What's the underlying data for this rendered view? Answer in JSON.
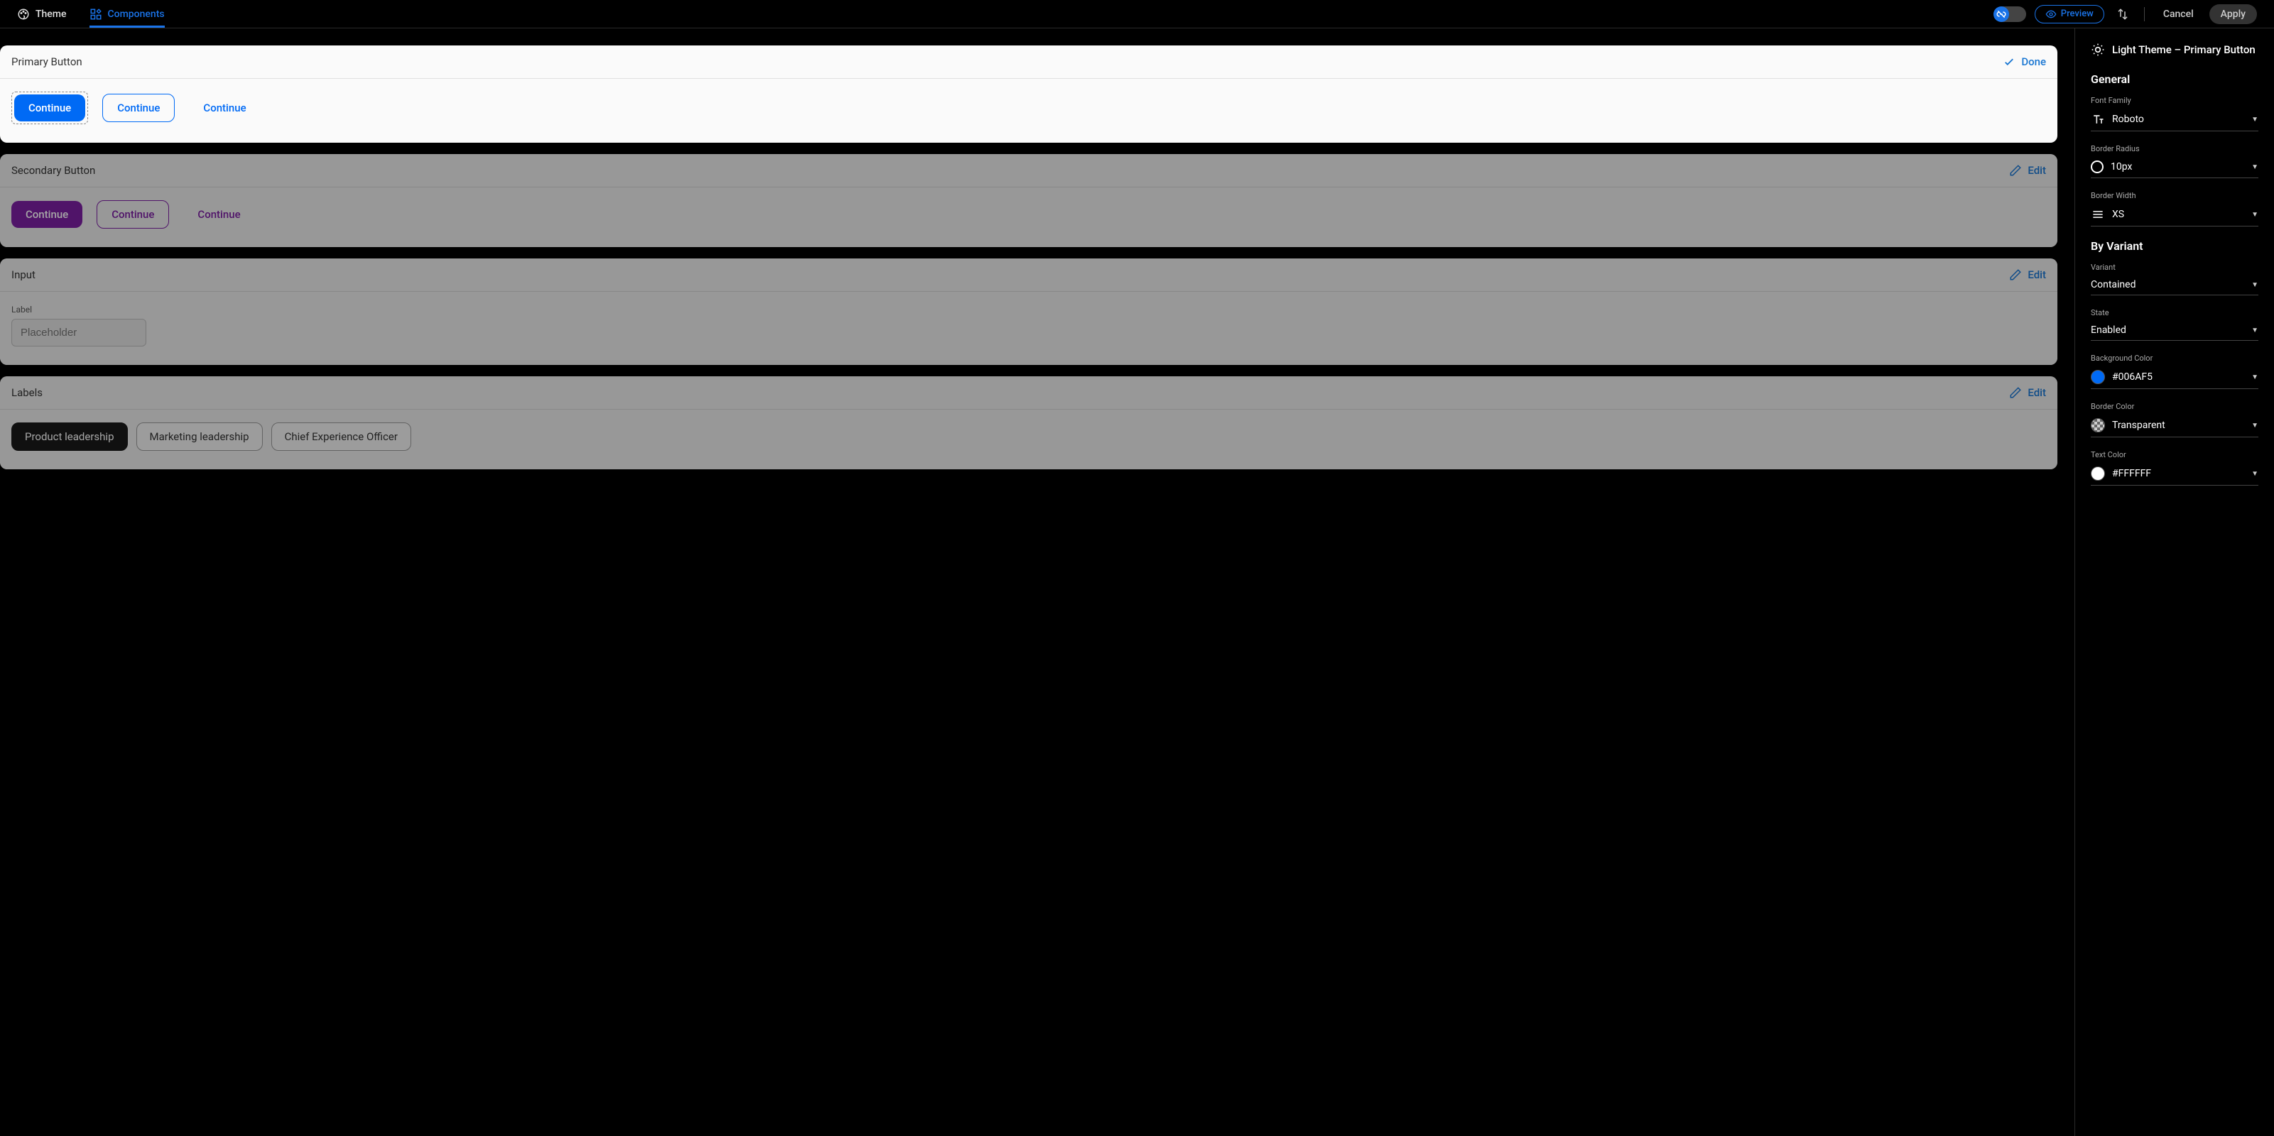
{
  "tabs": {
    "theme": "Theme",
    "components": "Components"
  },
  "topbar": {
    "preview": "Preview",
    "cancel": "Cancel",
    "apply": "Apply"
  },
  "cards": {
    "primary": {
      "title": "Primary Button",
      "action": "Done",
      "accent": "#006af5",
      "samples": [
        "Continue",
        "Continue",
        "Continue"
      ]
    },
    "secondary": {
      "title": "Secondary Button",
      "action": "Edit",
      "accent": "#7b1fa2",
      "samples": [
        "Continue",
        "Continue",
        "Continue"
      ]
    },
    "input": {
      "title": "Input",
      "action": "Edit",
      "label": "Label",
      "placeholder": "Placeholder"
    },
    "labels": {
      "title": "Labels",
      "action": "Edit",
      "chips": [
        "Product leadership",
        "Marketing leadership",
        "Chief Experience Officer"
      ]
    }
  },
  "panel": {
    "title": "Light Theme – Primary Button",
    "general_h": "General",
    "variant_h": "By Variant",
    "props": {
      "font_family": {
        "label": "Font Family",
        "value": "Roboto"
      },
      "border_radius": {
        "label": "Border Radius",
        "value": "10px"
      },
      "border_width": {
        "label": "Border Width",
        "value": "XS"
      },
      "variant": {
        "label": "Variant",
        "value": "Contained"
      },
      "state": {
        "label": "State",
        "value": "Enabled"
      },
      "bg_color": {
        "label": "Background Color",
        "value": "#006AF5",
        "swatch": "#006af5"
      },
      "border_color": {
        "label": "Border Color",
        "value": "Transparent"
      },
      "text_color": {
        "label": "Text Color",
        "value": "#FFFFFF",
        "swatch": "#ffffff"
      }
    }
  }
}
